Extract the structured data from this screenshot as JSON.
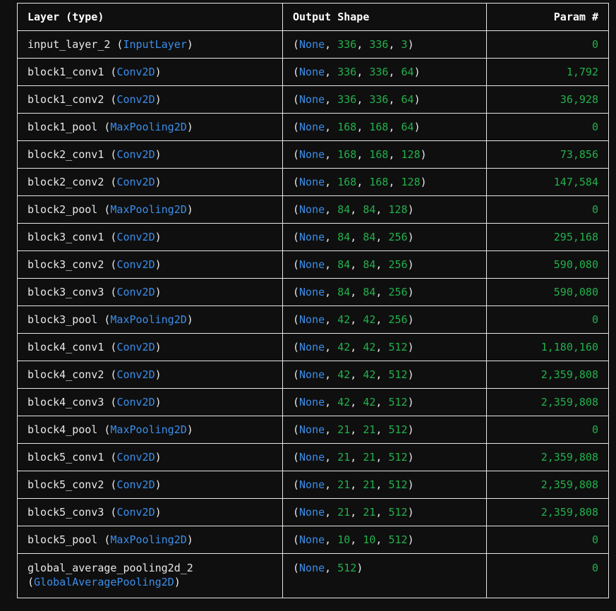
{
  "summary": {
    "headers": {
      "layer": "Layer (type)",
      "output_shape": "Output Shape",
      "params": "Param #"
    },
    "rows": [
      {
        "name": "input_layer_2",
        "type": "InputLayer",
        "shape": [
          "None",
          "336",
          "336",
          "3"
        ],
        "params": "0"
      },
      {
        "name": "block1_conv1",
        "type": "Conv2D",
        "shape": [
          "None",
          "336",
          "336",
          "64"
        ],
        "params": "1,792"
      },
      {
        "name": "block1_conv2",
        "type": "Conv2D",
        "shape": [
          "None",
          "336",
          "336",
          "64"
        ],
        "params": "36,928"
      },
      {
        "name": "block1_pool",
        "type": "MaxPooling2D",
        "shape": [
          "None",
          "168",
          "168",
          "64"
        ],
        "params": "0"
      },
      {
        "name": "block2_conv1",
        "type": "Conv2D",
        "shape": [
          "None",
          "168",
          "168",
          "128"
        ],
        "params": "73,856"
      },
      {
        "name": "block2_conv2",
        "type": "Conv2D",
        "shape": [
          "None",
          "168",
          "168",
          "128"
        ],
        "params": "147,584"
      },
      {
        "name": "block2_pool",
        "type": "MaxPooling2D",
        "shape": [
          "None",
          "84",
          "84",
          "128"
        ],
        "params": "0"
      },
      {
        "name": "block3_conv1",
        "type": "Conv2D",
        "shape": [
          "None",
          "84",
          "84",
          "256"
        ],
        "params": "295,168"
      },
      {
        "name": "block3_conv2",
        "type": "Conv2D",
        "shape": [
          "None",
          "84",
          "84",
          "256"
        ],
        "params": "590,080"
      },
      {
        "name": "block3_conv3",
        "type": "Conv2D",
        "shape": [
          "None",
          "84",
          "84",
          "256"
        ],
        "params": "590,080"
      },
      {
        "name": "block3_pool",
        "type": "MaxPooling2D",
        "shape": [
          "None",
          "42",
          "42",
          "256"
        ],
        "params": "0"
      },
      {
        "name": "block4_conv1",
        "type": "Conv2D",
        "shape": [
          "None",
          "42",
          "42",
          "512"
        ],
        "params": "1,180,160"
      },
      {
        "name": "block4_conv2",
        "type": "Conv2D",
        "shape": [
          "None",
          "42",
          "42",
          "512"
        ],
        "params": "2,359,808"
      },
      {
        "name": "block4_conv3",
        "type": "Conv2D",
        "shape": [
          "None",
          "42",
          "42",
          "512"
        ],
        "params": "2,359,808"
      },
      {
        "name": "block4_pool",
        "type": "MaxPooling2D",
        "shape": [
          "None",
          "21",
          "21",
          "512"
        ],
        "params": "0"
      },
      {
        "name": "block5_conv1",
        "type": "Conv2D",
        "shape": [
          "None",
          "21",
          "21",
          "512"
        ],
        "params": "2,359,808"
      },
      {
        "name": "block5_conv2",
        "type": "Conv2D",
        "shape": [
          "None",
          "21",
          "21",
          "512"
        ],
        "params": "2,359,808"
      },
      {
        "name": "block5_conv3",
        "type": "Conv2D",
        "shape": [
          "None",
          "21",
          "21",
          "512"
        ],
        "params": "2,359,808"
      },
      {
        "name": "block5_pool",
        "type": "MaxPooling2D",
        "shape": [
          "None",
          "10",
          "10",
          "512"
        ],
        "params": "0"
      },
      {
        "name": "global_average_pooling2d_2",
        "type": "GlobalAveragePooling2D",
        "shape": [
          "None",
          "512"
        ],
        "params": "0"
      }
    ]
  },
  "colors": {
    "background": "#0f0f0f",
    "text": "#e8e8e8",
    "type_blue": "#3b8eea",
    "number_green": "#22b14c",
    "border": "#e6e6e6"
  }
}
